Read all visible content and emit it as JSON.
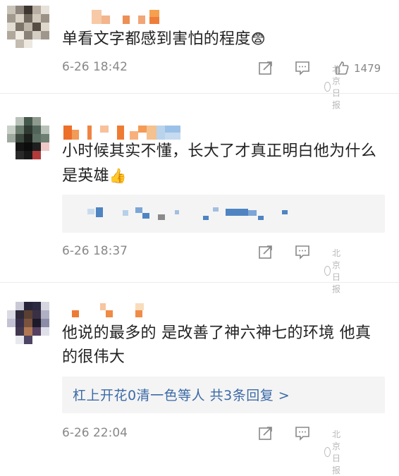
{
  "comments": [
    {
      "text": "单看文字都感到害怕的程度",
      "emoji": "😨",
      "time": "6-26 18:42",
      "like_count": "1479",
      "watermark": "北京日报"
    },
    {
      "text": "小时候其实不懂，长大了才真正明白他为什么是英雄",
      "emoji": "👍",
      "time": "6-26 18:37",
      "watermark": "北京日报"
    },
    {
      "text": "他说的最多的 是改善了神六神七的环境 他真的很伟大",
      "reply_summary": "杠上开花0清一色等人 共3条回复 >",
      "time": "6-26 22:04",
      "watermark": "北京日报"
    }
  ],
  "icons": {
    "share": "share-icon",
    "comment": "comment-icon",
    "like": "thumbs-up-icon",
    "brand": "wechat-logo-icon"
  },
  "colors": {
    "link": "#3b6aa7",
    "meta": "#888888",
    "reply_bg": "#f4f4f4"
  }
}
